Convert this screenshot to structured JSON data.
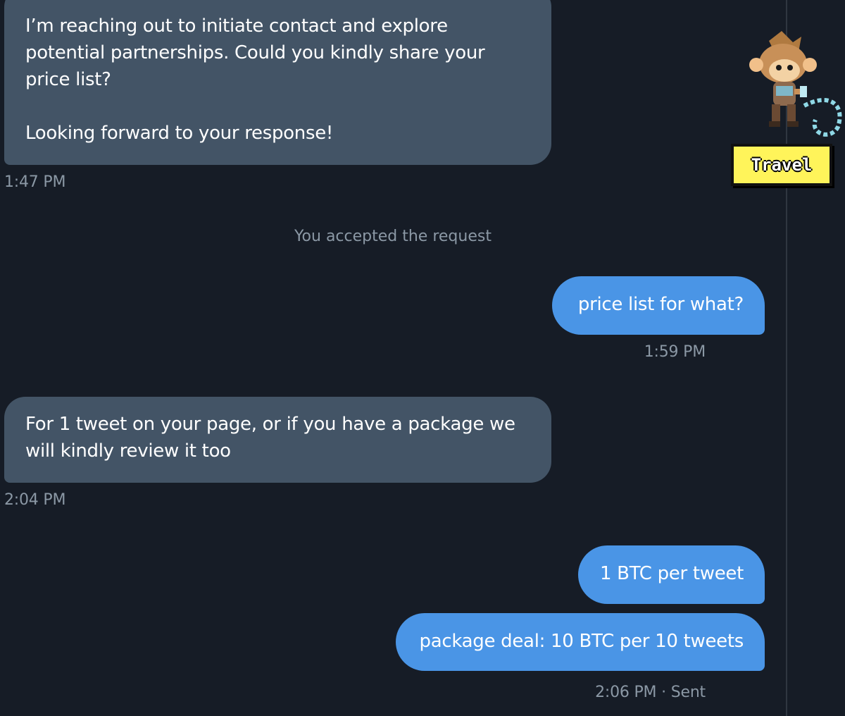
{
  "messages": {
    "m1": {
      "text": "I’m reaching out to initiate contact and explore\npotential partnerships. Could you kindly share your\nprice list?\n\nLooking forward to your response!",
      "time": "1:47 PM"
    },
    "system_notice": "You accepted the request",
    "m2": {
      "text": "price list for what?",
      "time": "1:59 PM"
    },
    "m3": {
      "text": "For 1 tweet on your page, or if you have a package we\nwill kindly review it too",
      "time": "2:04 PM"
    },
    "m4": {
      "text": "1 BTC per tweet"
    },
    "m5": {
      "text": "package deal: 10 BTC per 10 tweets",
      "time": "2:06 PM · Sent"
    }
  },
  "sidebar": {
    "badge_label": "Travel",
    "mascot_icon": "pixel-monkey-icon"
  },
  "colors": {
    "background": "#161c26",
    "incoming_bubble": "#435466",
    "outgoing_bubble": "#4a95e6",
    "muted_text": "#8b98a5",
    "badge": "#fff45a"
  }
}
